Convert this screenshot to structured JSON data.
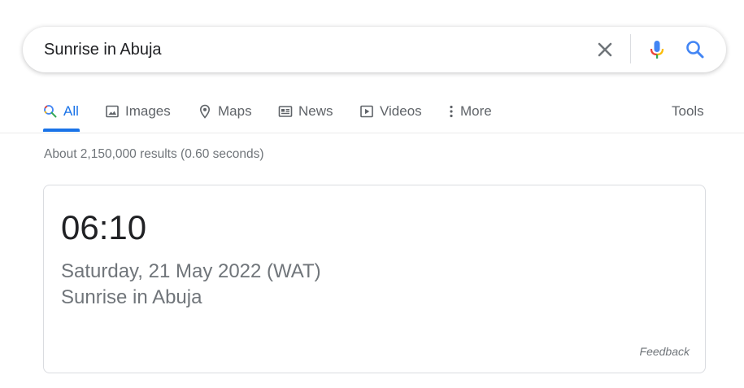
{
  "search": {
    "query": "Sunrise in Abuja"
  },
  "tabs": [
    {
      "label": "All",
      "icon": "search-icon",
      "active": true
    },
    {
      "label": "Images",
      "icon": "image-icon",
      "active": false
    },
    {
      "label": "Maps",
      "icon": "map-pin-icon",
      "active": false
    },
    {
      "label": "News",
      "icon": "news-icon",
      "active": false
    },
    {
      "label": "Videos",
      "icon": "video-icon",
      "active": false
    },
    {
      "label": "More",
      "icon": "more-vertical-icon",
      "active": false
    }
  ],
  "tools_label": "Tools",
  "result_stats": "About 2,150,000 results (0.60 seconds)",
  "answer": {
    "time": "06:10",
    "date": "Saturday, 21 May 2022 (WAT)",
    "label": "Sunrise in Abuja",
    "feedback": "Feedback"
  },
  "colors": {
    "accent": "#1a73e8",
    "text_primary": "#202124",
    "text_secondary": "#70757a",
    "border": "#dadce0"
  }
}
